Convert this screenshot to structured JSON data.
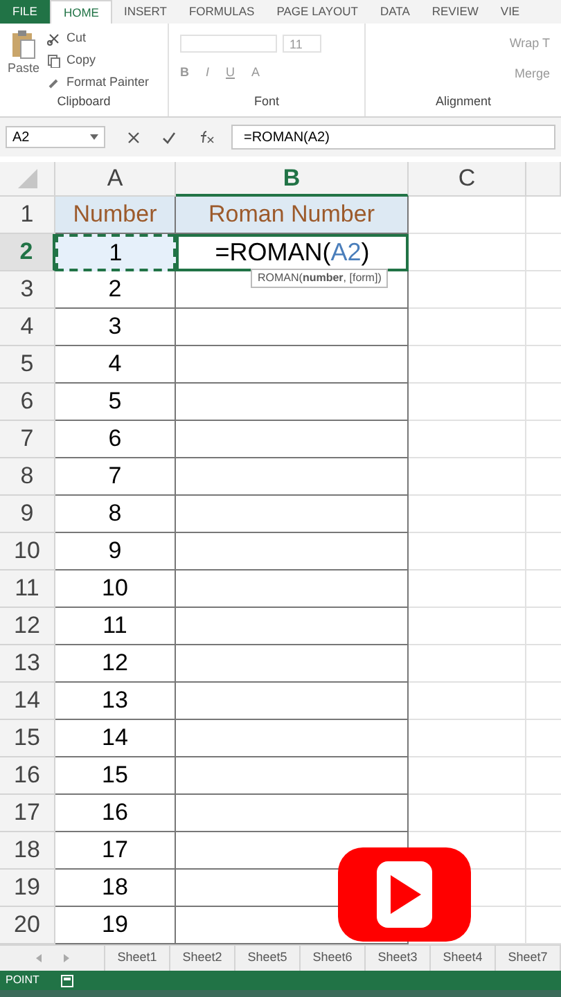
{
  "ribbon_tabs": [
    {
      "label": "FILE",
      "selected": false,
      "kind": "file"
    },
    {
      "label": "HOME",
      "selected": true,
      "kind": "tab"
    },
    {
      "label": "INSERT",
      "selected": false,
      "kind": "tab"
    },
    {
      "label": "FORMULAS",
      "selected": false,
      "kind": "tab"
    },
    {
      "label": "PAGE LAYOUT",
      "selected": false,
      "kind": "tab"
    },
    {
      "label": "DATA",
      "selected": false,
      "kind": "tab"
    },
    {
      "label": "REVIEW",
      "selected": false,
      "kind": "tab"
    },
    {
      "label": "VIE",
      "selected": false,
      "kind": "tab"
    }
  ],
  "clipboard": {
    "paste": "Paste",
    "cut": "Cut",
    "copy": "Copy",
    "format_painter": "Format Painter",
    "label": "Clipboard"
  },
  "font": {
    "size": "11",
    "bold": "B",
    "italic": "I",
    "underline": "U",
    "font_color": "A",
    "label": "Font"
  },
  "alignment": {
    "wrap": "Wrap T",
    "merge": "Merge",
    "label": "Alignment"
  },
  "formula_bar": {
    "name_box": "A2",
    "formula": "=ROMAN(A2)"
  },
  "columns": [
    {
      "label": "A",
      "selected": false
    },
    {
      "label": "B",
      "selected": true
    },
    {
      "label": "C",
      "selected": false
    }
  ],
  "rows": [
    {
      "num": "1",
      "selected": false,
      "a": "Number",
      "b": "Roman Number",
      "kind": "header"
    },
    {
      "num": "2",
      "selected": true,
      "a": "1",
      "b_parts": [
        {
          "text": "=ROMAN(",
          "kind": "plain"
        },
        {
          "text": "A2",
          "kind": "ref"
        },
        {
          "text": ")",
          "kind": "plain"
        }
      ],
      "kind": "formula"
    },
    {
      "num": "3",
      "selected": false,
      "a": "2",
      "kind": "value"
    },
    {
      "num": "4",
      "selected": false,
      "a": "3",
      "kind": "value"
    },
    {
      "num": "5",
      "selected": false,
      "a": "4",
      "kind": "value"
    },
    {
      "num": "6",
      "selected": false,
      "a": "5",
      "kind": "value"
    },
    {
      "num": "7",
      "selected": false,
      "a": "6",
      "kind": "value"
    },
    {
      "num": "8",
      "selected": false,
      "a": "7",
      "kind": "value"
    },
    {
      "num": "9",
      "selected": false,
      "a": "8",
      "kind": "value"
    },
    {
      "num": "10",
      "selected": false,
      "a": "9",
      "kind": "value"
    },
    {
      "num": "11",
      "selected": false,
      "a": "10",
      "kind": "value"
    },
    {
      "num": "12",
      "selected": false,
      "a": "11",
      "kind": "value"
    },
    {
      "num": "13",
      "selected": false,
      "a": "12",
      "kind": "value"
    },
    {
      "num": "14",
      "selected": false,
      "a": "13",
      "kind": "value"
    },
    {
      "num": "15",
      "selected": false,
      "a": "14",
      "kind": "value"
    },
    {
      "num": "16",
      "selected": false,
      "a": "15",
      "kind": "value"
    },
    {
      "num": "17",
      "selected": false,
      "a": "16",
      "kind": "value"
    },
    {
      "num": "18",
      "selected": false,
      "a": "17",
      "kind": "value"
    },
    {
      "num": "19",
      "selected": false,
      "a": "18",
      "kind": "value"
    },
    {
      "num": "20",
      "selected": false,
      "a": "19",
      "kind": "value"
    }
  ],
  "tooltip": "ROMAN(**number**, [form])",
  "sheet_tabs": [
    {
      "label": "Sheet1",
      "selected": false
    },
    {
      "label": "Sheet2",
      "selected": false
    },
    {
      "label": "Sheet5",
      "selected": false
    },
    {
      "label": "Sheet6",
      "selected": false
    },
    {
      "label": "Sheet3",
      "selected": false
    },
    {
      "label": "Sheet4",
      "selected": false
    },
    {
      "label": "Sheet7",
      "selected": false
    }
  ],
  "status_bar": {
    "mode": "POINT"
  }
}
